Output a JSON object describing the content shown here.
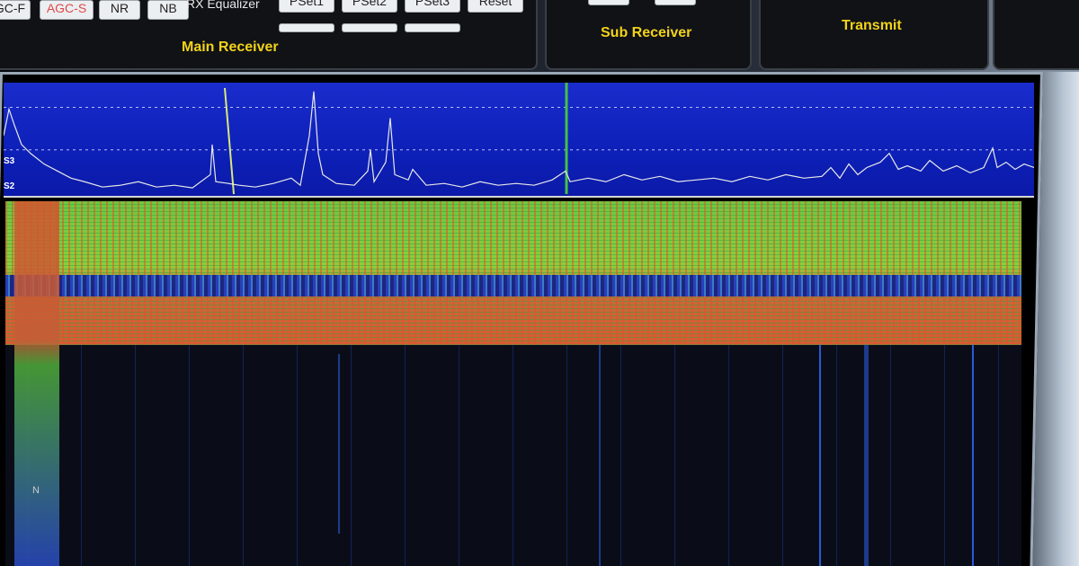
{
  "main_receiver": {
    "buttons": [
      "GC-F",
      "AGC-S",
      "NR",
      "NB"
    ],
    "rx_equalizer_label": "RX Equalizer",
    "preset_buttons": [
      "PSet1",
      "PSet2",
      "PSet3",
      "Reset"
    ],
    "title": "Main Receiver"
  },
  "sub_receiver": {
    "title": "Sub Receiver"
  },
  "transmit": {
    "title": "Transmit"
  },
  "spectrum": {
    "s_labels": [
      "S3",
      "S2"
    ],
    "trace_color": "#e8e8e8",
    "background_color": "#1122c0"
  },
  "waterfall": {
    "marker": "N"
  },
  "colors": {
    "accent_yellow": "#f2d21a",
    "agc_red": "#e04848"
  }
}
